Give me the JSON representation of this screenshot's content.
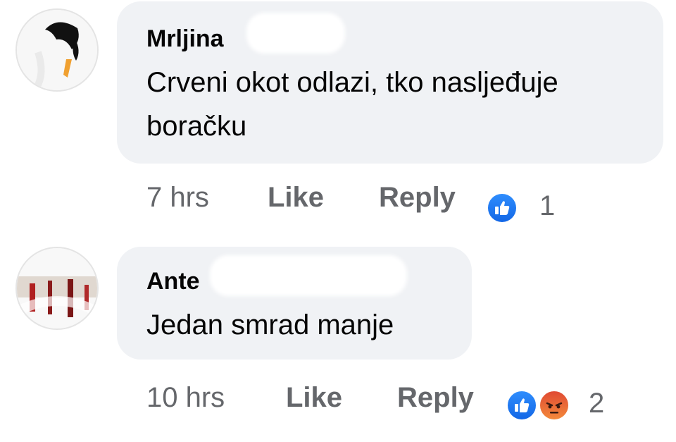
{
  "comments": [
    {
      "author": "Mrljina",
      "text": "Crveni okot odlazi, tko nasljeđuje boračku",
      "time": "7 hrs",
      "like_label": "Like",
      "reply_label": "Reply",
      "reactions": [
        "like-icon"
      ],
      "reaction_count": "1"
    },
    {
      "author": "Ante",
      "text": "Jedan smrad manje",
      "time": "10 hrs",
      "like_label": "Like",
      "reply_label": "Reply",
      "reactions": [
        "like-icon",
        "angry-icon"
      ],
      "reaction_count": "2"
    }
  ],
  "colors": {
    "bubble": "#f0f2f5",
    "meta_text": "#65676b",
    "primary_text": "#050505",
    "like_blue": "#1877f2",
    "angry_orange": "#f3893b"
  }
}
